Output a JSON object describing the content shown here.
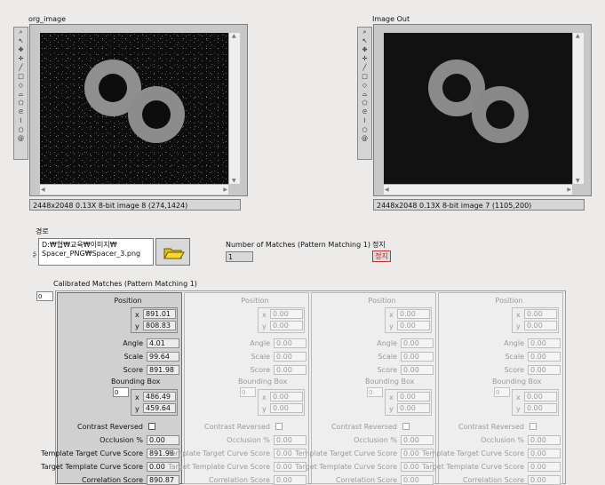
{
  "left_display": {
    "title": "org_image",
    "status": "2448x2048 0.13X 8-bit image 8     (274,1424)"
  },
  "right_display": {
    "title": "Image Out",
    "status": "2448x2048 0.13X 8-bit image 7     (1105,200)"
  },
  "tools": [
    "zoom-icon",
    "arrow-icon",
    "pan-icon",
    "crosshair-icon",
    "line-icon",
    "rectangle-icon",
    "rotated-rect-icon",
    "annulus-icon",
    "polygon-icon",
    "freehand-icon",
    "broken-line-icon",
    "oval-icon",
    "spiral-icon"
  ],
  "path": {
    "label": "경로",
    "line1": "D:₩협₩교육₩이미지₩",
    "line2": "Spacer_PNG₩Spacer_3.png"
  },
  "matches": {
    "label": "Number of Matches (Pattern Matching 1)",
    "value": "1"
  },
  "stop": {
    "label": "정지",
    "button": "정지"
  },
  "calibrated": {
    "label": "Calibrated Matches (Pattern Matching 1)",
    "index": "0",
    "field_labels": {
      "position": "Position",
      "angle": "Angle",
      "scale": "Scale",
      "score": "Score",
      "bounding_box": "Bounding Box",
      "contrast_reversed": "Contrast Reversed",
      "occlusion": "Occlusion %",
      "template_target": "Template Target Curve Score",
      "target_template": "Target Template Curve Score",
      "correlation": "Correlation Score",
      "x": "x",
      "y": "y"
    },
    "clusters": [
      {
        "pos_x": "891.01",
        "pos_y": "808.83",
        "angle": "4.01",
        "scale": "99.64",
        "score": "891.98",
        "bb_index": "0",
        "bb_x": "486.49",
        "bb_y": "459.64",
        "occlusion": "0.00",
        "template_target": "891.98",
        "target_template": "0.00",
        "correlation": "890.87"
      },
      {
        "pos_x": "0.00",
        "pos_y": "0.00",
        "angle": "0.00",
        "scale": "0.00",
        "score": "0.00",
        "bb_index": "0",
        "bb_x": "0.00",
        "bb_y": "0.00",
        "occlusion": "0.00",
        "template_target": "0.00",
        "target_template": "0.00",
        "correlation": "0.00"
      },
      {
        "pos_x": "0.00",
        "pos_y": "0.00",
        "angle": "0.00",
        "scale": "0.00",
        "score": "0.00",
        "bb_index": "0",
        "bb_x": "0.00",
        "bb_y": "0.00",
        "occlusion": "0.00",
        "template_target": "0.00",
        "target_template": "0.00",
        "correlation": "0.00"
      },
      {
        "pos_x": "0.00",
        "pos_y": "0.00",
        "angle": "0.00",
        "scale": "0.00",
        "score": "0.00",
        "bb_index": "0",
        "bb_x": "0.00",
        "bb_y": "0.00",
        "occlusion": "0.00",
        "template_target": "0.00",
        "target_template": "0.00",
        "correlation": "0.00"
      }
    ]
  }
}
